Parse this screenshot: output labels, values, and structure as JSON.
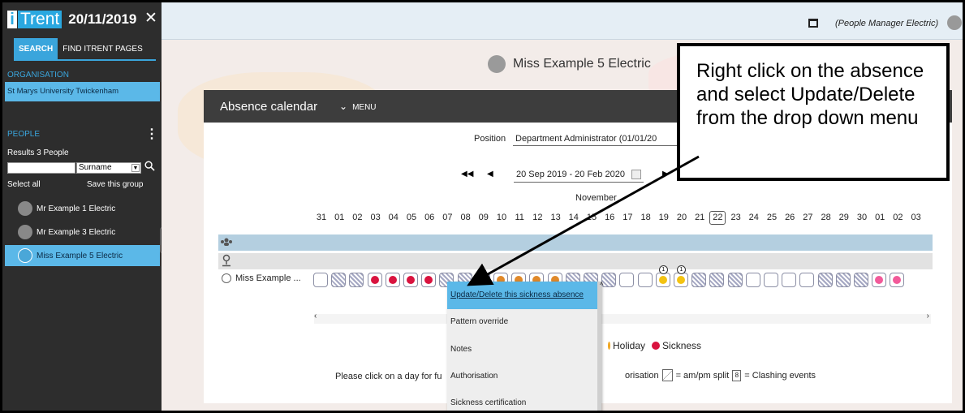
{
  "app": {
    "logo_i": "i",
    "logo_text": "Trent",
    "date": "20/11/2019",
    "close_glyph": "✕"
  },
  "sidebar": {
    "tabs": [
      {
        "label": "SEARCH",
        "active": true
      },
      {
        "label": "FIND ITRENT PAGES",
        "active": false
      }
    ],
    "organisation_label": "ORGANISATION",
    "organisation_value": "St Marys University Twickenham",
    "people_label": "PEOPLE",
    "results_text": "Results 3 People",
    "search_value": "",
    "sort_value": "Surname",
    "select_all": "Select all",
    "save_group": "Save this group",
    "people": [
      {
        "name": "Mr Example 1 Electric",
        "selected": false
      },
      {
        "name": "Mr Example 3 Electric",
        "selected": false
      },
      {
        "name": "Miss Example 5 Electric",
        "selected": true
      }
    ]
  },
  "topbar": {
    "role": "(People Manager Electric)"
  },
  "main": {
    "person_title": "Miss Example 5 Electric",
    "calendar_title": "Absence calendar",
    "menu_label": "MENU",
    "position_label": "Position",
    "position_value": "Department Administrator (01/01/20",
    "date_range": "20 Sep 2019 - 20 Feb 2020",
    "month_label": "November",
    "days": [
      "31",
      "01",
      "02",
      "03",
      "04",
      "05",
      "06",
      "07",
      "08",
      "09",
      "10",
      "11",
      "12",
      "13",
      "14",
      "15",
      "16",
      "17",
      "18",
      "19",
      "20",
      "21",
      "22",
      "23",
      "24",
      "25",
      "26",
      "27",
      "28",
      "29",
      "30",
      "01",
      "02",
      "03"
    ],
    "today_index": 22,
    "row_name": "Miss Example ...",
    "cells": [
      "empty",
      "hatch",
      "hatch",
      "sick",
      "sick",
      "sick",
      "sick",
      "hatch",
      "hatch",
      "hatch",
      "hol",
      "hol",
      "hol",
      "hol",
      "hatch",
      "hatch",
      "hatch",
      "empty",
      "empty",
      "sun",
      "sun",
      "hatch",
      "hatch",
      "hatch",
      "empty",
      "empty",
      "empty",
      "empty",
      "hatch",
      "hatch",
      "hatch",
      "pink",
      "pink"
    ],
    "clash_badge": "1",
    "legend_holiday": "Holiday",
    "legend_sickness": "Sickness",
    "footer_left": "Please click on a day for fu",
    "footer_right_1": "orisation",
    "footer_right_2": "= am/pm split",
    "footer_right_3": "= Clashing events",
    "clash_glyph": "8"
  },
  "context_menu": {
    "items": [
      {
        "label": "Update/Delete this sickness absence",
        "hover": true
      },
      {
        "label": "Pattern override",
        "hover": false
      },
      {
        "label": "Notes",
        "hover": false
      },
      {
        "label": "Authorisation",
        "hover": false
      },
      {
        "label": "Sickness certification",
        "hover": false
      }
    ]
  },
  "callout": {
    "text": "Right click on the absence and select Update/Delete from the drop down menu"
  },
  "colors": {
    "accent": "#3aa5dc",
    "sickness": "#d9133f",
    "holiday": "#e0892a",
    "pink": "#f25a9a"
  }
}
